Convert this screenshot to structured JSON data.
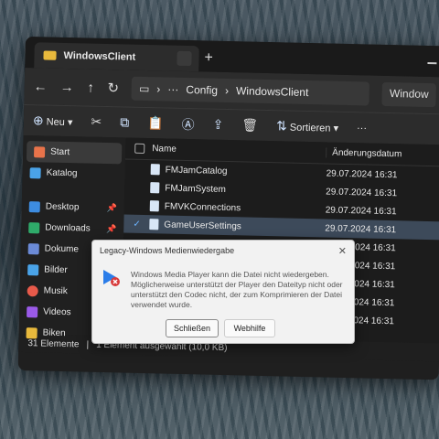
{
  "window": {
    "tab_title": "WindowsClient",
    "new_tab": "+"
  },
  "nav": {
    "breadcrumb_more": "···",
    "path": [
      "Config",
      "WindowsClient"
    ],
    "search": "Window"
  },
  "toolbar": {
    "new_label": "Neu",
    "sort_label": "Sortieren",
    "more": "···"
  },
  "sidebar": {
    "items": [
      {
        "label": "Start",
        "color": "#e8734a",
        "pinned": false
      },
      {
        "label": "Katalog",
        "color": "#4aa3e8",
        "pinned": false
      },
      {
        "label": "Desktop",
        "color": "#3d8ce0",
        "pinned": true
      },
      {
        "label": "Downloads",
        "color": "#2faa6a",
        "pinned": true
      },
      {
        "label": "Dokume",
        "color": "#6b8ad6",
        "pinned": false
      },
      {
        "label": "Bilder",
        "color": "#4aa3e8",
        "pinned": false
      },
      {
        "label": "Musik",
        "color": "#e85a4a",
        "pinned": false
      },
      {
        "label": "Videos",
        "color": "#9a5ae8",
        "pinned": false
      },
      {
        "label": "Biken",
        "color": "#e8b93c",
        "pinned": false
      }
    ]
  },
  "filelist": {
    "header_name": "Name",
    "header_date": "Änderungsdatum",
    "rows": [
      {
        "name": "FMJamCatalog",
        "date": "29.07.2024 16:31"
      },
      {
        "name": "FMJamSystem",
        "date": "29.07.2024 16:31"
      },
      {
        "name": "FMVKConnections",
        "date": "29.07.2024 16:31"
      },
      {
        "name": "GameUserSettings",
        "date": "29.07.2024 16:31"
      },
      {
        "name": "",
        "date": "29.07.2024 16:31"
      },
      {
        "name": "",
        "date": "29.07.2024 16:31"
      },
      {
        "name": "",
        "date": "29.07.2024 16:31"
      },
      {
        "name": "",
        "date": "29.07.2024 16:31"
      },
      {
        "name": "",
        "date": "29.07.2024 16:31"
      }
    ]
  },
  "status": {
    "count": "31 Elemente",
    "selection": "1 Element ausgewählt (10,0 KB)"
  },
  "dialog": {
    "title": "Legacy-Windows Medienwiedergabe",
    "message": "Windows Media Player kann die Datei nicht wiedergeben. Möglicherweise unterstützt der Player den Dateityp nicht oder unterstützt den Codec nicht, der zum Komprimieren der Datei verwendet wurde.",
    "close_button": "Schließen",
    "help_button": "Webhilfe"
  }
}
